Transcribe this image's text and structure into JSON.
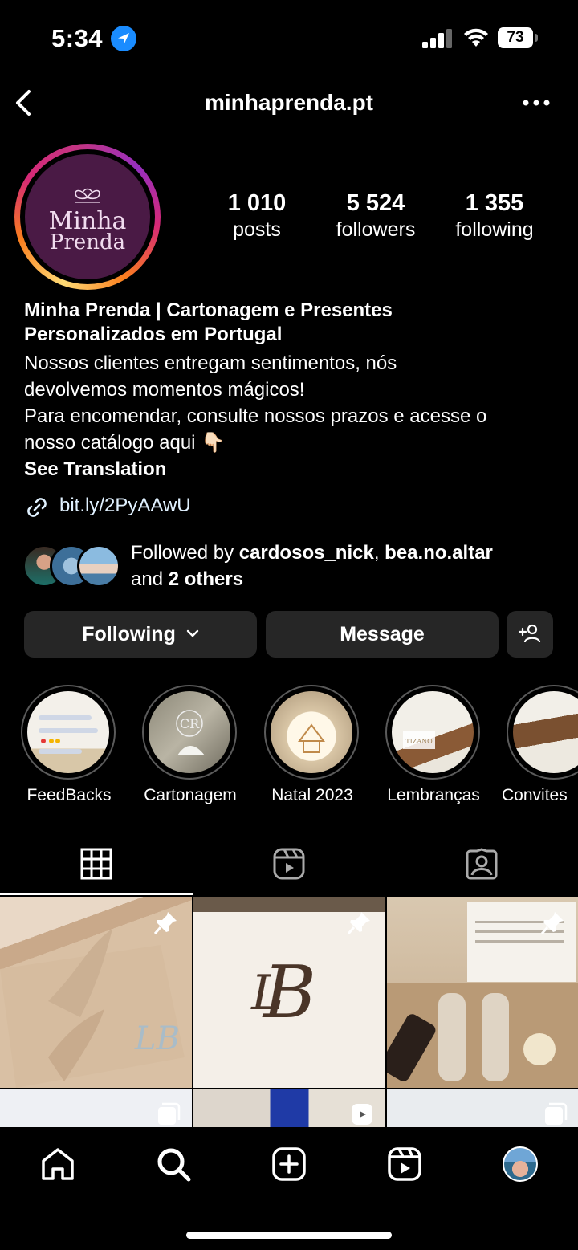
{
  "status_bar": {
    "time": "5:34",
    "battery": "73"
  },
  "header": {
    "username": "minhaprenda.pt"
  },
  "avatar": {
    "logo_line1": "Minha",
    "logo_line2": "Prenda"
  },
  "stats": [
    {
      "value": "1 010",
      "label": "posts"
    },
    {
      "value": "5 524",
      "label": "followers"
    },
    {
      "value": "1 355",
      "label": "following"
    }
  ],
  "bio": {
    "name_line1": "Minha Prenda | Cartonagem e Presentes",
    "name_line2": "Personalizados em Portugal",
    "line1": "Nossos clientes entregam sentimentos, nós",
    "line2": "devolvemos momentos mágicos!",
    "line3": "Para encomendar, consulte nossos prazos e acesse o",
    "line4": "nosso catálogo aqui 👇🏻",
    "see_translation": "See Translation",
    "link": "bit.ly/2PyAAwU"
  },
  "followed_by": {
    "prefix": "Followed by ",
    "user1": "cardosos_nick",
    "sep": ", ",
    "user2": "bea.no.altar",
    "and": "and ",
    "others": "2 others"
  },
  "buttons": {
    "following": "Following",
    "message": "Message"
  },
  "highlights": [
    {
      "label": "FeedBacks"
    },
    {
      "label": "Cartonagem"
    },
    {
      "label": "Natal 2023"
    },
    {
      "label": "Lembranças"
    },
    {
      "label": "Convites"
    }
  ],
  "icons": {
    "back": "chevron-left-icon",
    "more": "more-horizontal-icon",
    "grid_tab": "grid-icon",
    "reels_tab": "reels-icon",
    "tagged_tab": "tagged-icon",
    "home": "home-icon",
    "search": "search-icon",
    "create": "plus-square-icon",
    "reels": "reels-icon"
  },
  "colors": {
    "background": "#000000",
    "button": "#262626",
    "link": "#e0f1ff",
    "location_badge": "#1a8cff"
  }
}
